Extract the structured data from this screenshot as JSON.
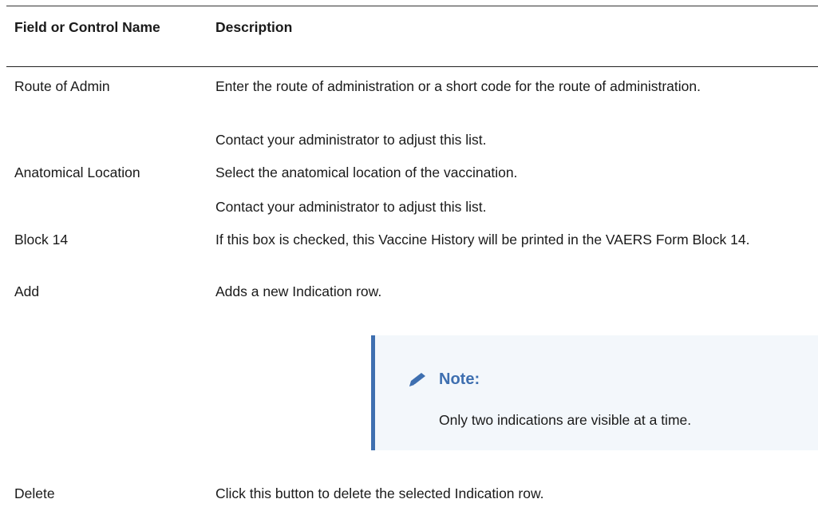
{
  "table": {
    "headers": {
      "field": "Field or Control Name",
      "description": "Description"
    },
    "rows": [
      {
        "field": "Route of Admin",
        "desc": [
          "Enter the route of administration or a short code for the route of administration.",
          "Contact your administrator to adjust this list."
        ]
      },
      {
        "field": "Anatomical Location",
        "desc": [
          "Select the anatomical location of the vaccination.",
          "Contact your administrator to adjust this list."
        ]
      },
      {
        "field": "Block 14",
        "desc": [
          "If this box is checked, this Vaccine History will be printed in the VAERS Form Block 14."
        ]
      },
      {
        "field": "Add",
        "desc": [
          "Adds a new Indication row."
        ]
      },
      {
        "field": "Delete",
        "desc": [
          "Click this button to delete the selected Indication row."
        ]
      }
    ]
  },
  "note": {
    "title": "Note:",
    "text": "Only two indications are visible at a time.",
    "icon": "pencil-icon",
    "accent_color": "#3e6fb0"
  }
}
